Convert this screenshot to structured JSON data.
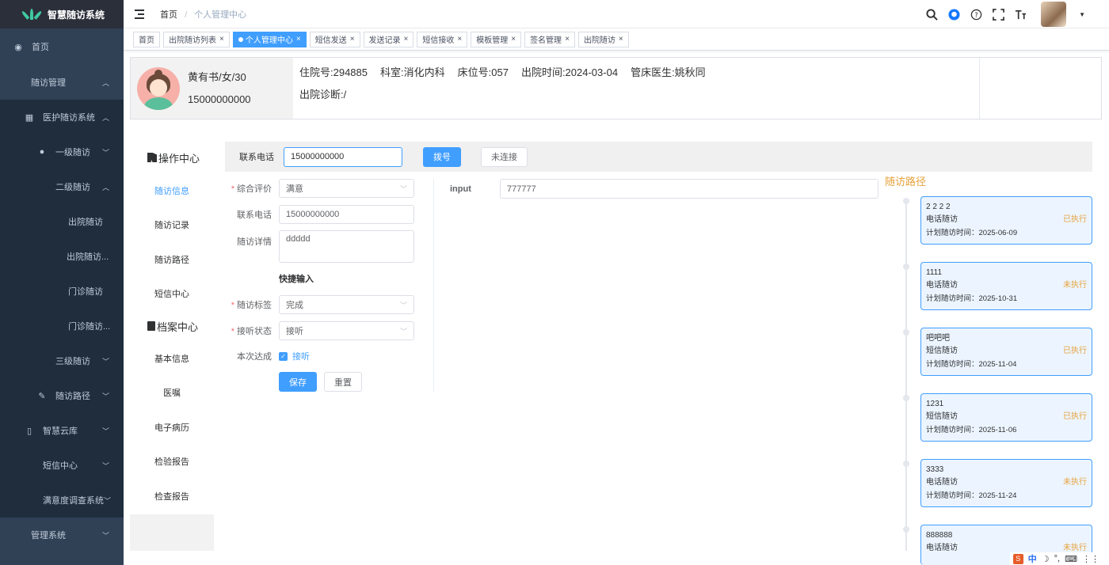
{
  "app": {
    "title": "智慧随访系统"
  },
  "sidebar": {
    "items": [
      {
        "label": "首页",
        "icon": "dashboard-icon"
      },
      {
        "label": "随访管理"
      },
      {
        "label": "医护随访系统",
        "icon": "grid-icon"
      },
      {
        "label": "一级随访",
        "icon": "user-icon"
      },
      {
        "label": "二级随访"
      },
      {
        "label": "出院随访"
      },
      {
        "label": "出院随访..."
      },
      {
        "label": "门诊随访"
      },
      {
        "label": "门诊随访..."
      },
      {
        "label": "三级随访"
      },
      {
        "label": "随访路径",
        "icon": "edit-icon"
      },
      {
        "label": "智慧云库",
        "icon": "book-icon"
      },
      {
        "label": "短信中心"
      },
      {
        "label": "满意度调查系统"
      },
      {
        "label": "管理系统"
      }
    ]
  },
  "header": {
    "breadcrumb": [
      "首页",
      "个人管理中心"
    ],
    "icons": [
      "search-icon",
      "github-icon",
      "help-icon",
      "fullscreen-icon",
      "font-size-icon"
    ]
  },
  "tags": [
    {
      "label": "首页",
      "active": false
    },
    {
      "label": "出院随访列表",
      "active": false
    },
    {
      "label": "个人管理中心",
      "active": true
    },
    {
      "label": "短信发送",
      "active": false
    },
    {
      "label": "发送记录",
      "active": false
    },
    {
      "label": "短信接收",
      "active": false
    },
    {
      "label": "模板管理",
      "active": false
    },
    {
      "label": "签名管理",
      "active": false
    },
    {
      "label": "出院随访",
      "active": false
    }
  ],
  "patient": {
    "name_line": "黄有书/女/30",
    "phone": "15000000000",
    "admission_no": "住院号:294885",
    "department": "科室:消化内科",
    "bed_no": "床位号:057",
    "discharge_time": "出院时间:2024-03-04",
    "doctor": "管床医生:姚秋同",
    "diagnosis": "出院诊断:/"
  },
  "opmenu": {
    "section1": "操作中心",
    "section1_items": [
      "随访信息",
      "随访记录",
      "随访路径",
      "短信中心"
    ],
    "section2": "档案中心",
    "section2_items": [
      "基本信息",
      "医嘱",
      "电子病历",
      "检验报告",
      "检查报告"
    ]
  },
  "phonebar": {
    "label": "联系电话",
    "value": "15000000000",
    "dial_label": "拨号",
    "status_label": "未连接"
  },
  "form": {
    "overall_label": "综合评价",
    "overall_value": "满意",
    "phone_label": "联系电话",
    "phone_value": "15000000000",
    "detail_label": "随访详情",
    "detail_value": "ddddd",
    "quick_label": "快捷输入",
    "tag_label": "随访标签",
    "tag_value": "完成",
    "answer_label": "接听状态",
    "answer_value": "接听",
    "achieved_label": "本次达成",
    "achieved_check": "接听",
    "save_label": "保存",
    "reset_label": "重置"
  },
  "extra_input": {
    "label": "input",
    "value": "777777"
  },
  "timeline": {
    "title": "随访路径",
    "time_prefix": "计划随访时间：",
    "items": [
      {
        "title": "2 2 2 2",
        "type": "电话随访",
        "status": "已执行",
        "date": "2025-06-09"
      },
      {
        "title": "1111",
        "type": "电话随访",
        "status": "未执行",
        "date": "2025-10-31"
      },
      {
        "title": "吧吧吧",
        "type": "短信随访",
        "status": "已执行",
        "date": "2025-11-04"
      },
      {
        "title": "1231",
        "type": "短信随访",
        "status": "已执行",
        "date": "2025-11-06"
      },
      {
        "title": "3333",
        "type": "电话随访",
        "status": "未执行",
        "date": "2025-11-24"
      },
      {
        "title": "888888",
        "type": "电话随访",
        "status": "未执行",
        "date": ""
      }
    ]
  },
  "ime": {
    "lang": "中"
  },
  "colors": {
    "primary": "#409eff",
    "sidebar": "#304156",
    "warning": "#e6a23c"
  }
}
